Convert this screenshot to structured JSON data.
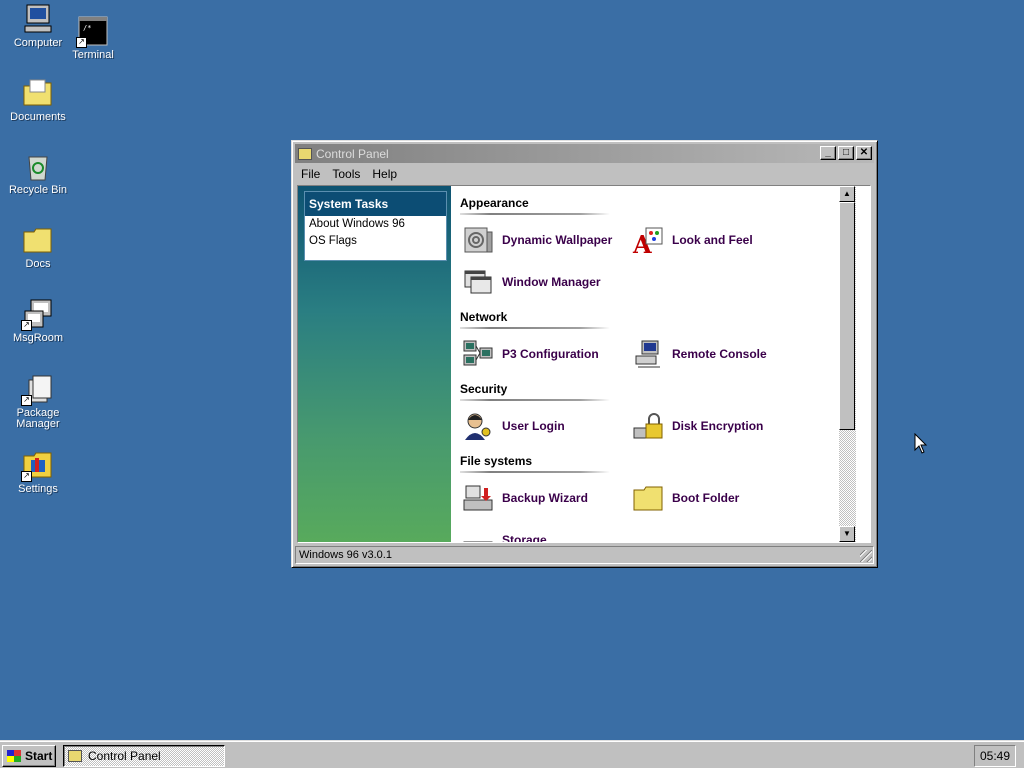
{
  "desktop": {
    "icons": [
      {
        "label": "Computer",
        "icon": "computer-icon"
      },
      {
        "label": "Terminal",
        "icon": "terminal-icon"
      },
      {
        "label": "Documents",
        "icon": "folder-documents-icon"
      },
      {
        "label": "Recycle Bin",
        "icon": "recycle-bin-icon"
      },
      {
        "label": "Docs",
        "icon": "folder-icon"
      },
      {
        "label": "MsgRoom",
        "icon": "msgroom-icon"
      },
      {
        "label": "Package Manager",
        "icon": "package-manager-icon"
      },
      {
        "label": "Settings",
        "icon": "settings-icon"
      }
    ]
  },
  "window": {
    "title": "Control Panel",
    "menu": [
      "File",
      "Tools",
      "Help"
    ],
    "sidebar": {
      "header": "System Tasks",
      "items": [
        "About Windows 96",
        "OS Flags"
      ]
    },
    "sections": [
      {
        "title": "Appearance",
        "items": [
          {
            "label": "Dynamic Wallpaper",
            "icon": "wallpaper-icon"
          },
          {
            "label": "Look and Feel",
            "icon": "look-and-feel-icon"
          },
          {
            "label": "Window Manager",
            "icon": "window-manager-icon"
          }
        ]
      },
      {
        "title": "Network",
        "items": [
          {
            "label": "P3 Configuration",
            "icon": "network-computers-icon"
          },
          {
            "label": "Remote Console",
            "icon": "remote-console-icon"
          }
        ]
      },
      {
        "title": "Security",
        "items": [
          {
            "label": "User Login",
            "icon": "user-key-icon"
          },
          {
            "label": "Disk Encryption",
            "icon": "padlock-icon"
          }
        ]
      },
      {
        "title": "File systems",
        "items": [
          {
            "label": "Backup Wizard",
            "icon": "backup-icon"
          },
          {
            "label": "Boot Folder",
            "icon": "folder-icon"
          },
          {
            "label": "Storage",
            "icon": "storage-icon"
          }
        ]
      }
    ],
    "status": "Windows 96 v3.0.1",
    "buttons": {
      "minimize": "_",
      "maximize": "□",
      "close": "✕"
    }
  },
  "taskbar": {
    "start": "Start",
    "items": [
      "Control Panel"
    ],
    "clock": "05:49"
  }
}
